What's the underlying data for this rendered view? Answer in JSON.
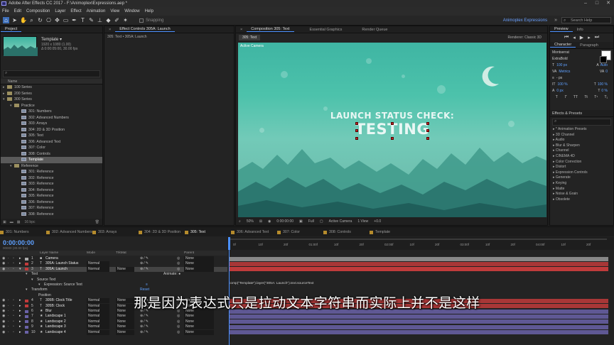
{
  "window": {
    "title": "Adobe After Effects CC 2017 - F:\\Animoplex\\Expressions.aep *"
  },
  "menu": [
    "File",
    "Edit",
    "Composition",
    "Layer",
    "Effect",
    "Animation",
    "View",
    "Window",
    "Help"
  ],
  "toolbar": {
    "snapping": "Snapping",
    "workspace": "Animoplex Expressions",
    "search_placeholder": "Search Help"
  },
  "project": {
    "tab": "Project",
    "comp_name": "Template ▾",
    "comp_info1": "1920 x 1080 (1.00)",
    "comp_info2": "Δ 0:00:05:00, 30.00 fps",
    "col_name": "Name",
    "bpc": "16 bpc",
    "items": [
      {
        "label": "100 Series",
        "indent": 0,
        "type": "folder",
        "open": false
      },
      {
        "label": "200 Series",
        "indent": 0,
        "type": "folder",
        "open": false
      },
      {
        "label": "300 Series",
        "indent": 0,
        "type": "folder",
        "open": true
      },
      {
        "label": "Practice",
        "indent": 1,
        "type": "folder",
        "open": true
      },
      {
        "label": "301: Numbers",
        "indent": 2,
        "type": "comp"
      },
      {
        "label": "302: Advanced Numbers",
        "indent": 2,
        "type": "comp"
      },
      {
        "label": "303: Arrays",
        "indent": 2,
        "type": "comp"
      },
      {
        "label": "304: 2D & 3D Position",
        "indent": 2,
        "type": "comp"
      },
      {
        "label": "305: Text",
        "indent": 2,
        "type": "comp"
      },
      {
        "label": "306: Advanced Text",
        "indent": 2,
        "type": "comp"
      },
      {
        "label": "307: Color",
        "indent": 2,
        "type": "comp"
      },
      {
        "label": "308: Controls",
        "indent": 2,
        "type": "comp"
      },
      {
        "label": "Template",
        "indent": 2,
        "type": "comp",
        "selected": true
      },
      {
        "label": "Reference",
        "indent": 1,
        "type": "folder",
        "open": true
      },
      {
        "label": "301: Reference",
        "indent": 2,
        "type": "comp"
      },
      {
        "label": "302: Reference",
        "indent": 2,
        "type": "comp"
      },
      {
        "label": "303: Reference",
        "indent": 2,
        "type": "comp"
      },
      {
        "label": "304: Reference",
        "indent": 2,
        "type": "comp"
      },
      {
        "label": "305: Reference",
        "indent": 2,
        "type": "comp"
      },
      {
        "label": "306: Reference",
        "indent": 2,
        "type": "comp"
      },
      {
        "label": "307: Reference",
        "indent": 2,
        "type": "comp"
      },
      {
        "label": "308: Reference",
        "indent": 2,
        "type": "comp"
      }
    ]
  },
  "effect_controls": {
    "tab": "Effect Controls 305A: Launch",
    "path": "305: Text • 305A: Launch"
  },
  "composition": {
    "tab": "Composition 305: Text",
    "tab2": "Essential Graphics",
    "tab3": "Render Queue",
    "subtab": "305: Text",
    "renderer_label": "Renderer:",
    "renderer": "Classic 3D",
    "active_camera": "Active Camera",
    "line1": "LAUNCH STATUS CHECK:",
    "line2": "TESTING",
    "zoom": "50%",
    "time": "0:00:00:00",
    "quality": "Full",
    "view": "Active Camera",
    "views": "1 View",
    "exposure": "+0.0"
  },
  "preview": {
    "tab": "Preview",
    "info_tab": "Info"
  },
  "character": {
    "tab": "Character",
    "para_tab": "Paragraph",
    "font": "Montserrat",
    "style": "ExtraBold",
    "size": "100 px",
    "leading": "Auto",
    "kern": "Metrics",
    "track": "0",
    "stroke": "- px",
    "vscale": "100 %",
    "hscale": "100 %",
    "baseline": "0 px",
    "tsume": "0 %"
  },
  "effects": {
    "tab": "Effects & Presets",
    "items": [
      "* Animation Presets",
      "3D Channel",
      "Audio",
      "Blur & Sharpen",
      "Channel",
      "CINEMA 4D",
      "Color Correction",
      "Distort",
      "Expression Controls",
      "Generate",
      "Keying",
      "Matte",
      "Noise & Grain",
      "Obsolete"
    ]
  },
  "timeline": {
    "tabs": [
      "301: Numbers",
      "302: Advanced Numbers",
      "303: Arrays",
      "304: 2D & 3D Position",
      "305: Text",
      "306: Advanced Text",
      "307: Color",
      "308: Controls",
      "Template"
    ],
    "active_tab": "305: Text",
    "time": "0:00:00:00",
    "frame_info": "00000 (30.00 fps)",
    "headers": {
      "layer_name": "Layer Name",
      "mode": "Mode",
      "trkmat": "TrkMat",
      "parent": "Parent"
    },
    "ruler": [
      "0f",
      "10f",
      "20f",
      "01:00f",
      "10f",
      "20f",
      "02:00f",
      "10f",
      "20f",
      "03:00f",
      "10f",
      "20f",
      "04:00f",
      "10f",
      "20f"
    ],
    "layers": [
      {
        "num": "1",
        "name": "Camera",
        "mode": "",
        "trk": "",
        "parent": "None",
        "color": "#a9a9a9"
      },
      {
        "num": "2",
        "name": "305A: Launch Status",
        "mode": "Normal",
        "trk": "",
        "parent": "None",
        "color": "#c03b3b"
      },
      {
        "num": "3",
        "name": "305A: Launch",
        "mode": "Normal",
        "trk": "None",
        "parent": "None",
        "color": "#c03b3b",
        "selected": true
      },
      {
        "num": "4",
        "name": "305B: Clock Title",
        "mode": "Normal",
        "trk": "None",
        "parent": "None",
        "color": "#c03b3b"
      },
      {
        "num": "5",
        "name": "305B: Clock",
        "mode": "Normal",
        "trk": "None",
        "parent": "None",
        "color": "#c03b3b"
      },
      {
        "num": "6",
        "name": "Blur",
        "mode": "Normal",
        "trk": "None",
        "parent": "None",
        "color": "#6a62a8"
      },
      {
        "num": "7",
        "name": "Landscape 1",
        "mode": "Normal",
        "trk": "None",
        "parent": "None",
        "color": "#6a62a8"
      },
      {
        "num": "8",
        "name": "Landscape 2",
        "mode": "Normal",
        "trk": "None",
        "parent": "None",
        "color": "#6a62a8"
      },
      {
        "num": "9",
        "name": "Landscape 3",
        "mode": "Normal",
        "trk": "None",
        "parent": "None",
        "color": "#6a62a8"
      },
      {
        "num": "10",
        "name": "Landscape 4",
        "mode": "Normal",
        "trk": "None",
        "parent": "None",
        "color": "#6a62a8"
      }
    ],
    "props": {
      "text": "Text",
      "animate": "Animate: ●",
      "source_text": "Source Text",
      "expression_label": "Expression: Source Text",
      "transform": "Transform",
      "reset": "Reset",
      "position": "Position",
      "expression_code": "comp(\"Template\").layer(\"305A: Launch\").text.sourceText"
    }
  },
  "subtitle": "那是因为表达式只是拉动文本字符串而实际上并不是这样"
}
